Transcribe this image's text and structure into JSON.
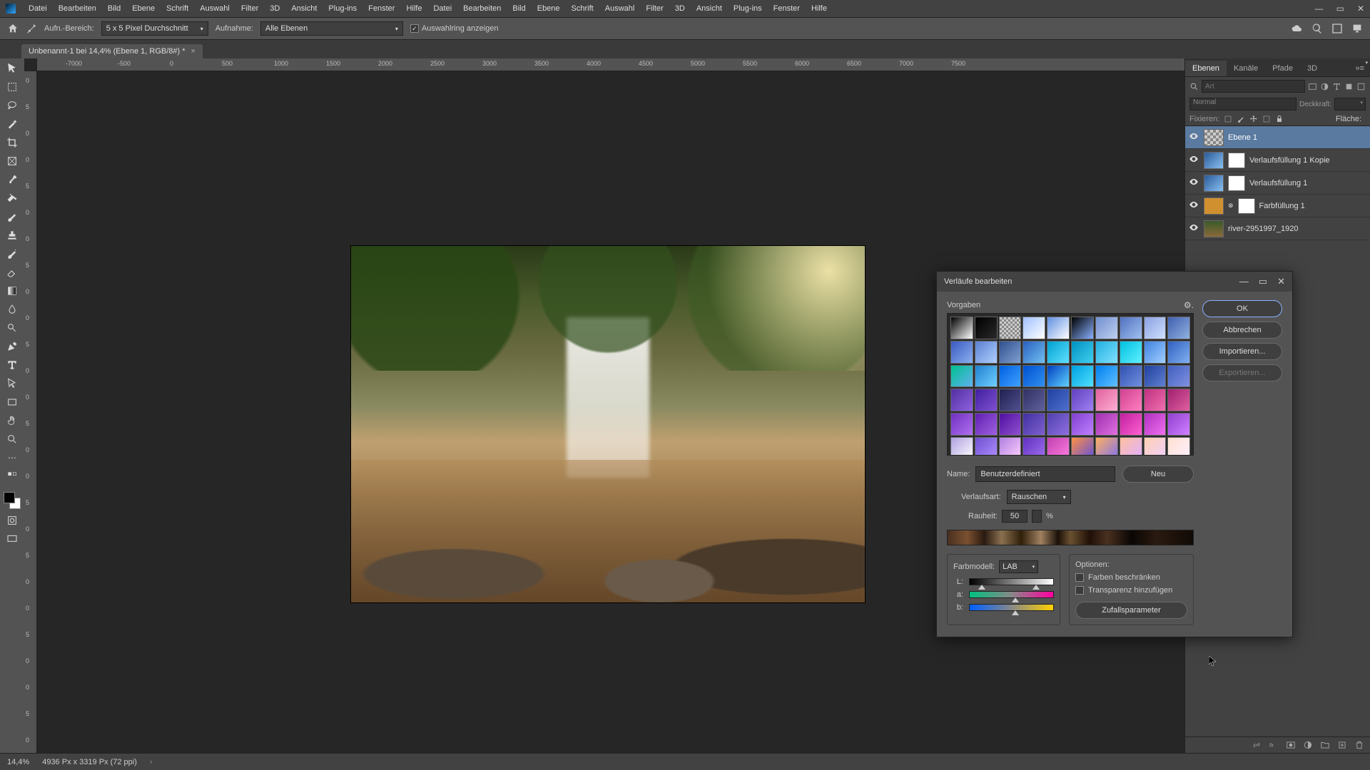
{
  "menubar": [
    "Datei",
    "Bearbeiten",
    "Bild",
    "Ebene",
    "Schrift",
    "Auswahl",
    "Filter",
    "3D",
    "Ansicht",
    "Plug-ins",
    "Fenster",
    "Hilfe"
  ],
  "optionsbar": {
    "sample_label": "Aufn.-Bereich:",
    "sample_value": "5 x 5 Pixel Durchschnitt",
    "sample_from_label": "Aufnahme:",
    "sample_from_value": "Alle Ebenen",
    "show_ring_label": "Auswahlring anzeigen"
  },
  "doc_tab": {
    "title": "Unbenannt-1 bei 14,4% (Ebene 1, RGB/8#) *"
  },
  "ruler_h": [
    "-7000",
    "-500",
    "0",
    "500",
    "1000",
    "1500",
    "2000",
    "2500",
    "3000",
    "3500",
    "4000",
    "4500",
    "5000",
    "5500",
    "6000",
    "6500",
    "7000",
    "7500"
  ],
  "ruler_v": [
    "0",
    "5",
    "0",
    "0",
    "5",
    "0",
    "0",
    "5",
    "0",
    "0",
    "5",
    "0",
    "0",
    "5",
    "0",
    "0",
    "5",
    "0",
    "5",
    "0",
    "0",
    "5",
    "0",
    "0",
    "5",
    "0",
    "0"
  ],
  "layers_panel": {
    "tabs": [
      "Ebenen",
      "Kanäle",
      "Pfade",
      "3D"
    ],
    "search_placeholder": "Art",
    "blend_mode": "Normal",
    "opacity_label": "Deckkraft:",
    "opacity_value": "",
    "lock_label": "Fixieren:",
    "fill_label": "Fläche:",
    "fill_value": "",
    "layers": [
      {
        "name": "Ebene 1",
        "thumb": "checker",
        "selected": true
      },
      {
        "name": "Verlaufsfüllung 1 Kopie",
        "thumb": "grad",
        "mask": true
      },
      {
        "name": "Verlaufsfüllung 1",
        "thumb": "grad",
        "mask": true
      },
      {
        "name": "Farbfüllung 1",
        "thumb": "fill",
        "mask": true,
        "link": true
      },
      {
        "name": "river-2951997_1920",
        "thumb": "img"
      }
    ]
  },
  "statusbar": {
    "zoom": "14,4%",
    "dims": "4936 Px x 3319 Px (72 ppi)"
  },
  "dialog": {
    "title": "Verläufe bearbeiten",
    "presets_label": "Vorgaben",
    "buttons": {
      "ok": "OK",
      "cancel": "Abbrechen",
      "import": "Importieren...",
      "export": "Exportieren...",
      "neu": "Neu"
    },
    "name_label": "Name:",
    "name_value": "Benutzerdefiniert",
    "type_label": "Verlaufsart:",
    "type_value": "Rauschen",
    "roughness_label": "Rauheit:",
    "roughness_value": "50",
    "roughness_unit": "%",
    "colormodel_label": "Farbmodell:",
    "colormodel_value": "LAB",
    "sliders": {
      "L": "L:",
      "a": "a:",
      "b": "b:"
    },
    "options_label": "Optionen:",
    "restrict_colors": "Farben beschränken",
    "add_transparency": "Transparenz hinzufügen",
    "randomize": "Zufallsparameter",
    "preset_colors": [
      "linear-gradient(135deg,#000,#fff)",
      "linear-gradient(135deg,#000,transparent)",
      "repeating-conic-gradient(#888 0 25%,#ccc 0 50%) 0 0/6px 6px",
      "linear-gradient(135deg,#a0c0ff,#fff)",
      "linear-gradient(135deg,#6090e0,#fff)",
      "linear-gradient(135deg,#000,#88b0ff)",
      "linear-gradient(135deg,#7090d0,#c0d0f0)",
      "linear-gradient(135deg,#5070c0,#a0c0f0)",
      "linear-gradient(135deg,#8aa0e0,#d0e0ff)",
      "linear-gradient(135deg,#4060b0,#90b0e0)",
      "linear-gradient(135deg,#3a5ac0,#8ab0f0)",
      "linear-gradient(135deg,#5a80d0,#b0d0ff)",
      "linear-gradient(135deg,#305090,#80a0d0)",
      "linear-gradient(135deg,#2a60c0,#70c0f0)",
      "linear-gradient(135deg,#00a0d0,#60e0ff)",
      "linear-gradient(135deg,#0090c0,#40d0f0)",
      "linear-gradient(135deg,#20b0e0,#80e0ff)",
      "linear-gradient(135deg,#00c0e0,#60f0ff)",
      "linear-gradient(135deg,#4080e0,#a0d0ff)",
      "linear-gradient(135deg,#3060c0,#80b0f0)",
      "linear-gradient(135deg,#00c090,#60b0f0)",
      "linear-gradient(135deg,#2080d0,#70d0ff)",
      "linear-gradient(135deg,#0060e0,#40a0ff)",
      "linear-gradient(135deg,#0050d0,#3090f0)",
      "linear-gradient(135deg,#0040c0,#60d0ff)",
      "linear-gradient(135deg,#00a0e0,#50e0ff)",
      "linear-gradient(135deg,#0080f0,#60c0ff)",
      "linear-gradient(135deg,#3050b0,#7090e0)",
      "linear-gradient(135deg,#2040a0,#6080d0)",
      "linear-gradient(135deg,#4060c0,#8090e0)",
      "linear-gradient(135deg,#5030a0,#9060e0)",
      "linear-gradient(135deg,#4020a0,#8050d0)",
      "linear-gradient(135deg,#202050,#505090)",
      "linear-gradient(135deg,#303060,#6060a0)",
      "linear-gradient(135deg,#2040a0,#5070d0)",
      "linear-gradient(135deg,#6040c0,#a080f0)",
      "linear-gradient(135deg,#e060a0,#ffb0d0)",
      "linear-gradient(135deg,#d04090,#ff80c0)",
      "linear-gradient(135deg,#c03080,#f070b0)",
      "linear-gradient(135deg,#a02070,#e060a0)",
      "linear-gradient(135deg,#7030c0,#b070f0)",
      "linear-gradient(135deg,#6020b0,#a060e0)",
      "linear-gradient(135deg,#5010a0,#9050d0)",
      "linear-gradient(135deg,#4030a0,#8060d0)",
      "linear-gradient(135deg,#5040b0,#9070e0)",
      "linear-gradient(135deg,#8040d0,#c080ff)",
      "linear-gradient(135deg,#a030b0,#e070e0)",
      "linear-gradient(135deg,#c020a0,#ff60d0)",
      "linear-gradient(135deg,#b030c0,#f070f0)",
      "linear-gradient(135deg,#9040d0,#d080ff)",
      "linear-gradient(135deg,#b0a0e0,#ffffff)",
      "linear-gradient(135deg,#7050d0,#b090ff)",
      "linear-gradient(135deg,#b080e0,#ffd0ff)",
      "linear-gradient(135deg,#6030c0,#a070f0)",
      "linear-gradient(135deg,#c040b0,#ff80e0)",
      "linear-gradient(135deg,#ff9040,#6050e0)",
      "linear-gradient(135deg,#ffb060,#8070f0)",
      "linear-gradient(135deg,#ffc0a0,#e0b0ff)",
      "linear-gradient(135deg,#ffd0b0,#f0d0ff)",
      "linear-gradient(135deg,#ffe0d0,#fff0ff)"
    ]
  }
}
